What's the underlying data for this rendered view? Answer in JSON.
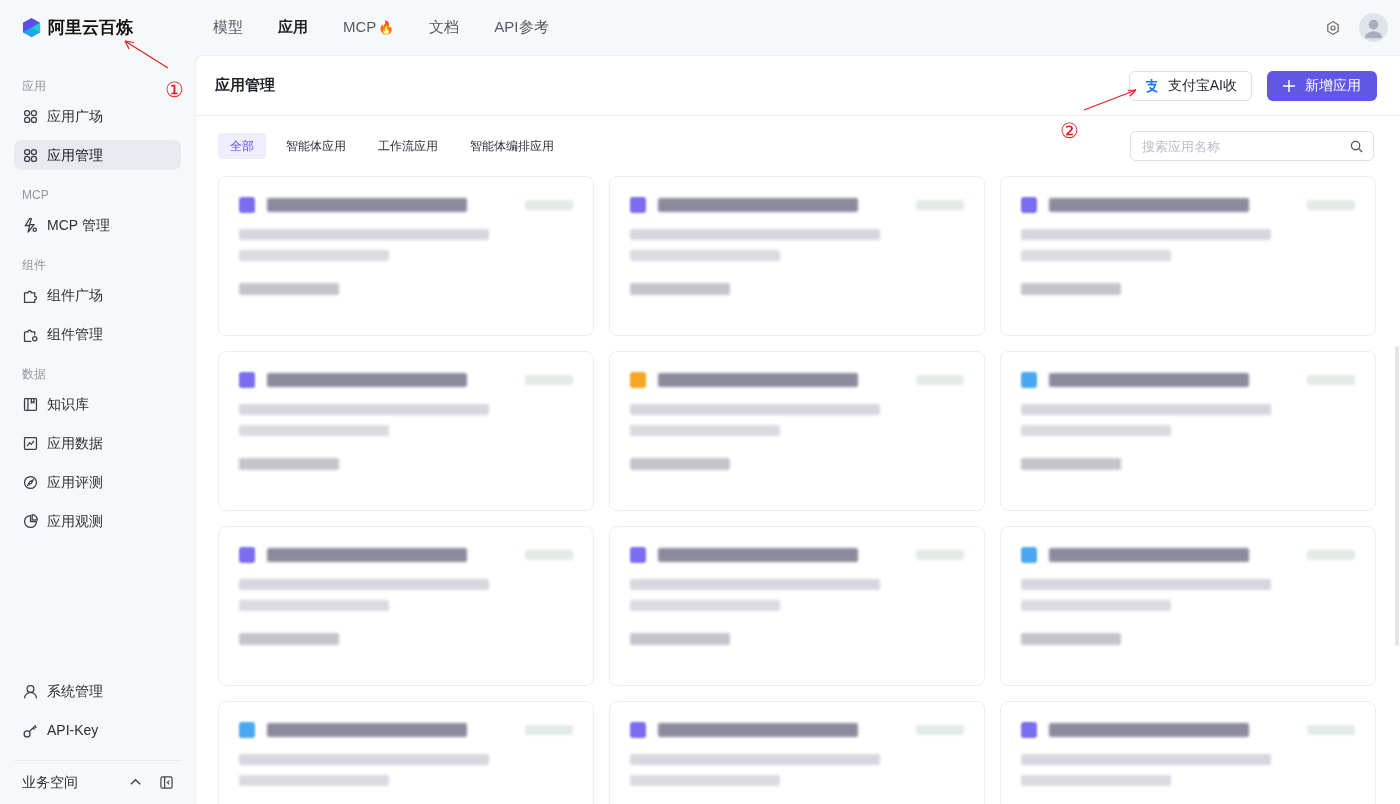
{
  "brand": {
    "name": "阿里云百炼"
  },
  "top_nav": [
    {
      "label": "模型",
      "selected": false
    },
    {
      "label": "应用",
      "selected": true
    },
    {
      "label": "MCP",
      "selected": false,
      "badge": "🔥"
    },
    {
      "label": "文档",
      "selected": false
    },
    {
      "label": "API参考",
      "selected": false
    }
  ],
  "sidebar": {
    "sections": [
      {
        "title": "应用",
        "items": [
          {
            "label": "应用广场",
            "kind": "grid",
            "selected": false
          },
          {
            "label": "应用管理",
            "kind": "grid",
            "selected": true
          }
        ]
      },
      {
        "title": "MCP",
        "items": [
          {
            "label": "MCP 管理",
            "kind": "bolt",
            "selected": false
          }
        ]
      },
      {
        "title": "组件",
        "items": [
          {
            "label": "组件广场",
            "kind": "puzzle",
            "selected": false
          },
          {
            "label": "组件管理",
            "kind": "puzzle-gear",
            "selected": false
          }
        ]
      },
      {
        "title": "数据",
        "items": [
          {
            "label": "知识库",
            "kind": "book",
            "selected": false
          },
          {
            "label": "应用数据",
            "kind": "chart",
            "selected": false
          },
          {
            "label": "应用评测",
            "kind": "compass",
            "selected": false
          },
          {
            "label": "应用观测",
            "kind": "pie",
            "selected": false
          }
        ]
      }
    ],
    "bottom_items": [
      {
        "label": "系统管理",
        "kind": "user",
        "selected": false
      },
      {
        "label": "API-Key",
        "kind": "key",
        "selected": false
      }
    ],
    "workspace": "业务空间"
  },
  "page": {
    "title": "应用管理",
    "buttons": [
      {
        "kind": "secondary",
        "label": "支付宝AI收"
      },
      {
        "kind": "primary",
        "label": "新增应用"
      }
    ],
    "filters": [
      {
        "label": "全部",
        "selected": true
      },
      {
        "label": "智能体应用",
        "selected": false
      },
      {
        "label": "工作流应用",
        "selected": false
      },
      {
        "label": "智能体编排应用",
        "selected": false
      }
    ],
    "search": {
      "placeholder": "搜索应用名称"
    },
    "cards": [
      {
        "color": "#7c6cf0"
      },
      {
        "color": "#7c6cf0"
      },
      {
        "color": "#7c6cf0"
      },
      {
        "color": "#7c6cf0"
      },
      {
        "color": "#f5a623"
      },
      {
        "color": "#4aa8f0"
      },
      {
        "color": "#7c6cf0"
      },
      {
        "color": "#7c6cf0"
      },
      {
        "color": "#4aa8f0"
      },
      {
        "color": "#4aa8f0"
      },
      {
        "color": "#7c6cf0"
      },
      {
        "color": "#7c6cf0"
      }
    ]
  },
  "annotations": [
    {
      "label": "①"
    },
    {
      "label": "②"
    }
  ]
}
